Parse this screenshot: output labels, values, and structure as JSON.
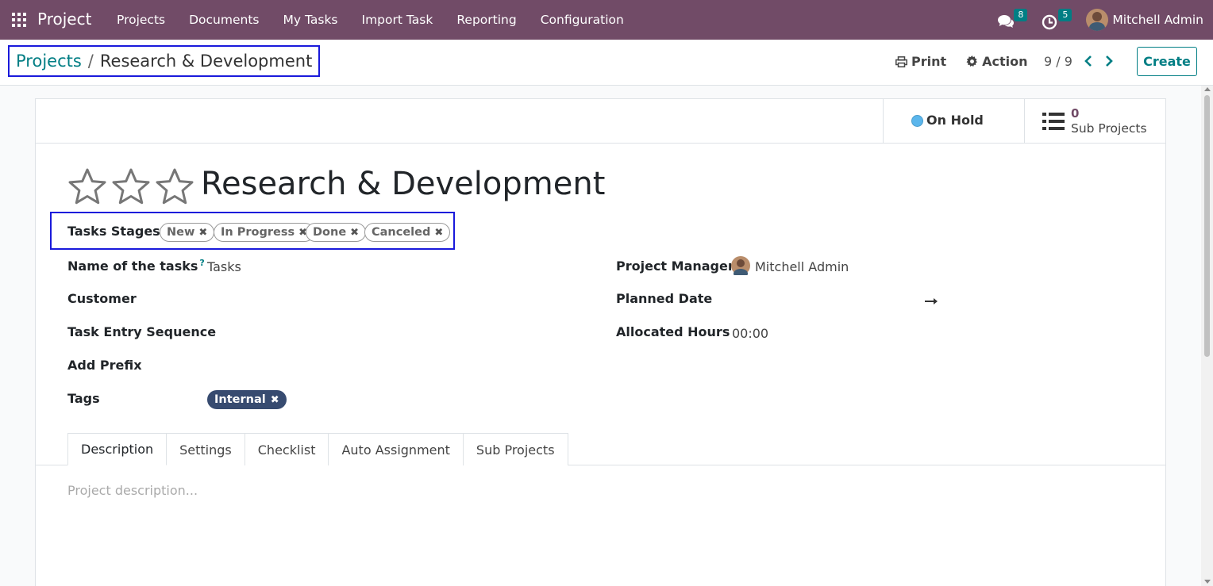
{
  "navbar": {
    "brand": "Project",
    "menu": [
      "Projects",
      "Documents",
      "My Tasks",
      "Import Task",
      "Reporting",
      "Configuration"
    ],
    "messages_count": "8",
    "activities_count": "5",
    "user_name": "Mitchell Admin",
    "colors": {
      "bar": "#714B67",
      "badge": "#017e84"
    }
  },
  "control_panel": {
    "breadcrumb_parent": "Projects",
    "breadcrumb_separator": "/",
    "breadcrumb_current": "Research & Development",
    "print_label": "Print",
    "action_label": "Action",
    "pager": "9 / 9",
    "create_label": "Create"
  },
  "button_box": {
    "status_label": "On Hold",
    "status_color": "#5bb6ec",
    "sub_projects_count": "0",
    "sub_projects_label": "Sub Projects"
  },
  "form": {
    "priority_stars_filled": 0,
    "priority_stars_total": 3,
    "title": "Research & Development",
    "tasks_stages_label": "Tasks Stages",
    "tasks_stages": [
      "New",
      "In Progress",
      "Done",
      "Canceled"
    ],
    "name_of_tasks_label": "Name of the tasks",
    "name_of_tasks_help": "?",
    "name_of_tasks_value": "Tasks",
    "customer_label": "Customer",
    "task_entry_sequence_label": "Task Entry Sequence",
    "add_prefix_label": "Add Prefix",
    "tags_label": "Tags",
    "tags": [
      "Internal"
    ],
    "project_manager_label": "Project Manager",
    "project_manager_value": "Mitchell Admin",
    "planned_date_label": "Planned Date",
    "allocated_hours_label": "Allocated Hours",
    "allocated_hours_value": "00:00"
  },
  "tabs": [
    "Description",
    "Settings",
    "Checklist",
    "Auto Assignment",
    "Sub Projects"
  ],
  "active_tab": "Description",
  "description_placeholder": "Project description..."
}
